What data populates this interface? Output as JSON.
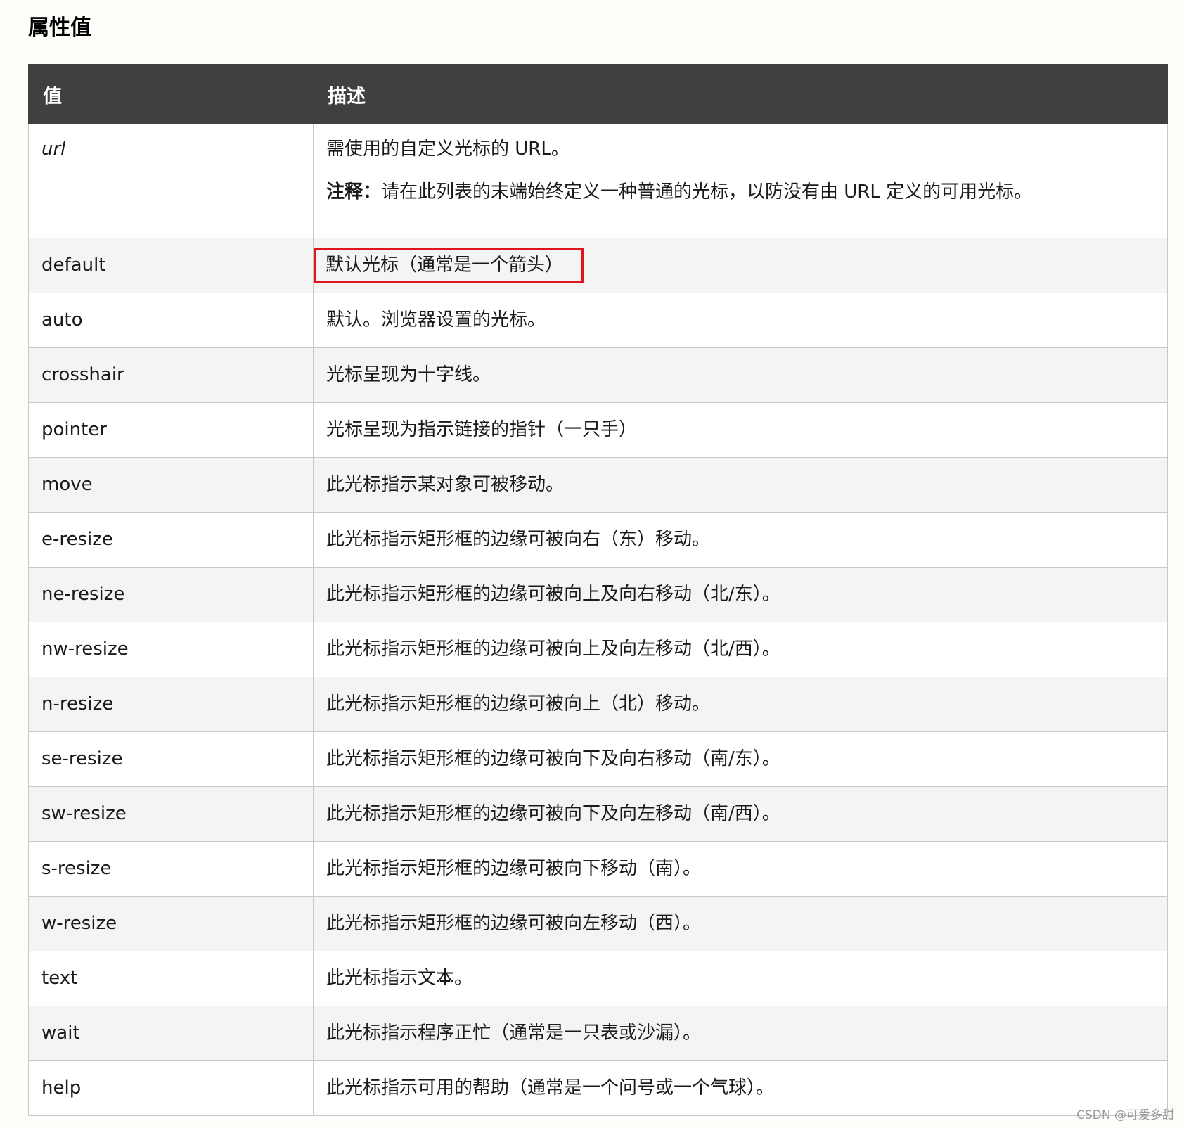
{
  "page": {
    "title": "属性值"
  },
  "table": {
    "headers": {
      "value": "值",
      "description": "描述"
    },
    "url_row": {
      "value": "url",
      "desc_line1": "需使用的自定义光标的 URL。",
      "note_label": "注释：",
      "note_text": "请在此列表的末端始终定义一种普通的光标，以防没有由 URL 定义的可用光标。"
    },
    "rows": [
      {
        "value": "default",
        "desc": "默认光标（通常是一个箭头）"
      },
      {
        "value": "auto",
        "desc": "默认。浏览器设置的光标。"
      },
      {
        "value": "crosshair",
        "desc": "光标呈现为十字线。"
      },
      {
        "value": "pointer",
        "desc": "光标呈现为指示链接的指针（一只手）"
      },
      {
        "value": "move",
        "desc": "此光标指示某对象可被移动。"
      },
      {
        "value": "e-resize",
        "desc": "此光标指示矩形框的边缘可被向右（东）移动。"
      },
      {
        "value": "ne-resize",
        "desc": "此光标指示矩形框的边缘可被向上及向右移动（北/东）。"
      },
      {
        "value": "nw-resize",
        "desc": "此光标指示矩形框的边缘可被向上及向左移动（北/西）。"
      },
      {
        "value": "n-resize",
        "desc": "此光标指示矩形框的边缘可被向上（北）移动。"
      },
      {
        "value": "se-resize",
        "desc": "此光标指示矩形框的边缘可被向下及向右移动（南/东）。"
      },
      {
        "value": "sw-resize",
        "desc": "此光标指示矩形框的边缘可被向下及向左移动（南/西）。"
      },
      {
        "value": "s-resize",
        "desc": "此光标指示矩形框的边缘可被向下移动（南）。"
      },
      {
        "value": "w-resize",
        "desc": "此光标指示矩形框的边缘可被向左移动（西）。"
      },
      {
        "value": "text",
        "desc": "此光标指示文本。"
      },
      {
        "value": "wait",
        "desc": "此光标指示程序正忙（通常是一只表或沙漏）。"
      },
      {
        "value": "help",
        "desc": "此光标指示可用的帮助（通常是一个问号或一个气球）。"
      }
    ]
  },
  "highlight_color": "#e0151b",
  "header_color": "#404040",
  "watermark": "CSDN @可爱多甜"
}
